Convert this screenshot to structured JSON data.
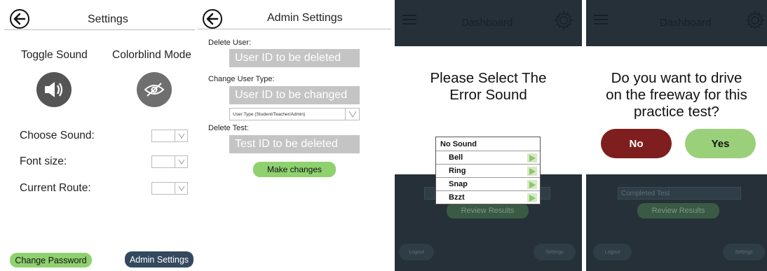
{
  "settings": {
    "title": "Settings",
    "toggle_sound_label": "Toggle Sound",
    "colorblind_label": "Colorblind Mode",
    "choose_sound_label": "Choose Sound:",
    "font_size_label": "Font size:",
    "current_route_label": "Current Route:",
    "change_password_label": "Change Password",
    "admin_settings_label": "Admin Settings"
  },
  "admin": {
    "title": "Admin Settings",
    "delete_user_label": "Delete User:",
    "delete_user_placeholder": "User ID to be deleted",
    "change_user_type_label": "Change User Type:",
    "change_user_placeholder": "User ID to be changed",
    "user_type_option": "User Type (Student/Teacher/Admin)",
    "delete_test_label": "Delete Test:",
    "delete_test_placeholder": "Test ID to be deleted",
    "make_changes_label": "Make changes"
  },
  "dashboard_sound": {
    "header_title": "Dashboard",
    "prompt_line1": "Please Select The",
    "prompt_line2": "Error Sound",
    "sounds": [
      "No Sound",
      "Bell",
      "Ring",
      "Snap",
      "Bzzt"
    ],
    "review_results_label": "Review Results",
    "logout_label": "Logout",
    "settings_label": "Settings"
  },
  "dashboard_freeway": {
    "header_title": "Dashboard",
    "prompt_line1": "Do you want to drive",
    "prompt_line2": "on the freeway for this",
    "prompt_line3": "practice test?",
    "no_label": "No",
    "yes_label": "Yes",
    "select_value": "Completed Test",
    "review_results_label": "Review Results",
    "logout_label": "Logout",
    "settings_label": "Settings"
  },
  "colors": {
    "green": "#8fd16f",
    "navy": "#34495e",
    "dark_bg": "#253038",
    "no_red": "#7f1e1e",
    "yes_green": "#9bd07a",
    "input_gray": "#c4c4c4"
  },
  "icons": [
    "back-arrow-icon",
    "speaker-icon",
    "eye-slash-icon",
    "chevron-down-icon",
    "hamburger-icon",
    "gear-icon",
    "play-icon"
  ]
}
